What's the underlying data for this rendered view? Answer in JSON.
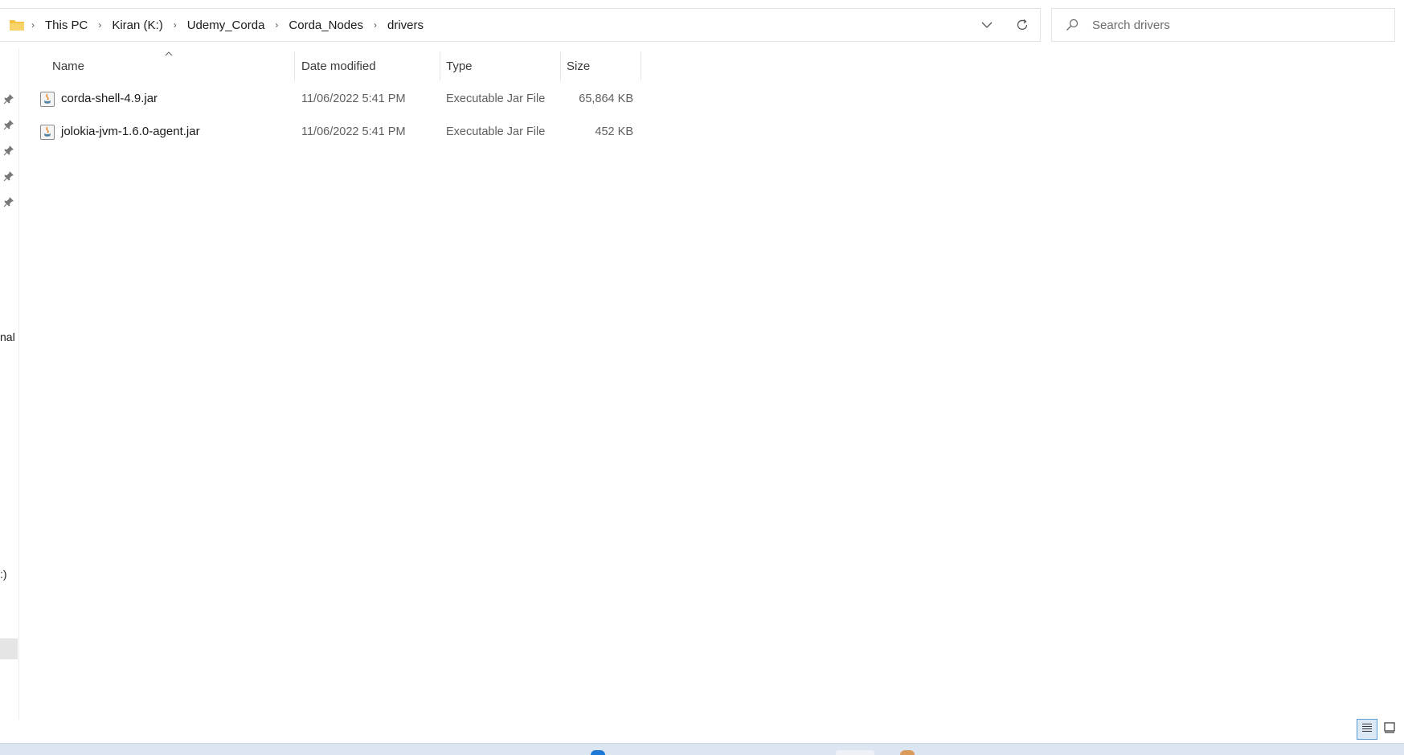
{
  "breadcrumb": {
    "items": [
      "This PC",
      "Kiran (K:)",
      "Udemy_Corda",
      "Corda_Nodes",
      "drivers"
    ]
  },
  "search": {
    "placeholder": "Search drivers"
  },
  "columns": {
    "name": "Name",
    "date": "Date modified",
    "type": "Type",
    "size": "Size"
  },
  "files": [
    {
      "name": "corda-shell-4.9.jar",
      "date": "11/06/2022 5:41 PM",
      "type": "Executable Jar File",
      "size": "65,864 KB"
    },
    {
      "name": "jolokia-jvm-1.6.0-agent.jar",
      "date": "11/06/2022 5:41 PM",
      "type": "Executable Jar File",
      "size": "452 KB"
    }
  ],
  "nav": {
    "partial_label_1": "nal",
    "partial_label_2": ":)"
  },
  "colors": {
    "accent": "#5b9bd5",
    "folder": "#f5c242",
    "taskbar": "#dce6f2"
  },
  "icons": [
    "folder-icon",
    "chevron-right-icon",
    "chevron-down-icon",
    "refresh-icon",
    "search-icon",
    "pin-icon",
    "jar-file-icon",
    "details-view-icon",
    "tiles-view-icon"
  ]
}
